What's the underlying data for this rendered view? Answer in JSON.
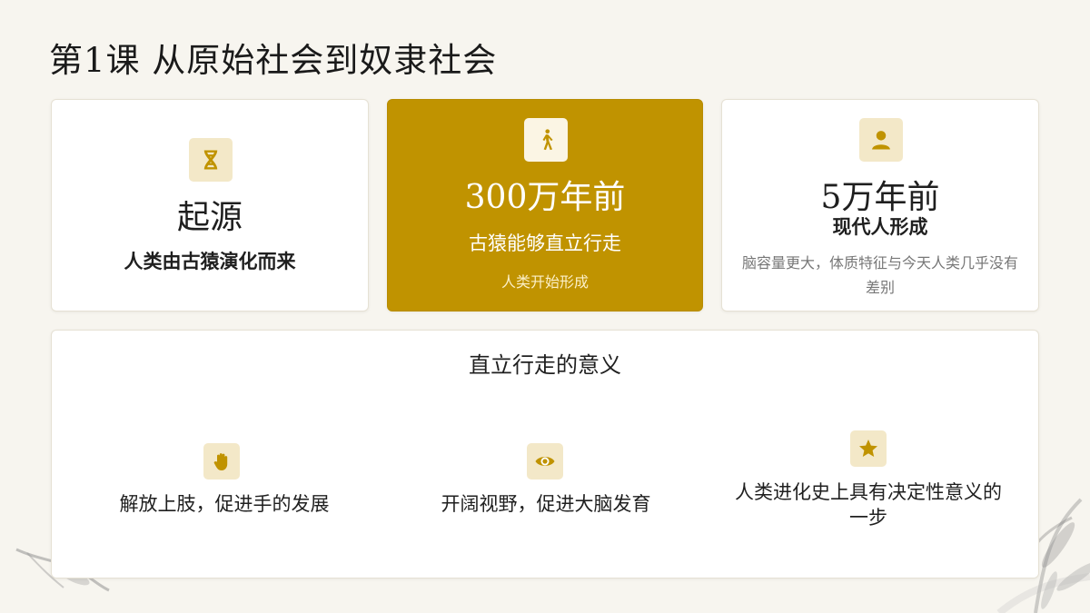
{
  "title": "第1课  从原始社会到奴隶社会",
  "cards": [
    {
      "icon": "dna-icon",
      "heading": "起源",
      "subtitle": "人类由古猿演化而来"
    },
    {
      "icon": "walking-person-icon",
      "heading": "300万年前",
      "subtitle": "古猿能够直立行走",
      "note": "人类开始形成"
    },
    {
      "icon": "person-icon",
      "heading": "5万年前",
      "subtitle": "现代人形成",
      "note": "脑容量更大，体质特征与今天人类几乎没有差别"
    }
  ],
  "significance": {
    "heading": "直立行走的意义",
    "points": [
      {
        "icon": "hand-icon",
        "text": "解放上肢，促进手的发展"
      },
      {
        "icon": "eye-icon",
        "text": "开阔视野，促进大脑发育"
      },
      {
        "icon": "star-icon",
        "text": "人类进化史上具有决定性意义的一步"
      }
    ]
  },
  "colors": {
    "accent": "#c09300",
    "icon_bg": "#f3e8c8",
    "background": "#f7f5ef"
  }
}
